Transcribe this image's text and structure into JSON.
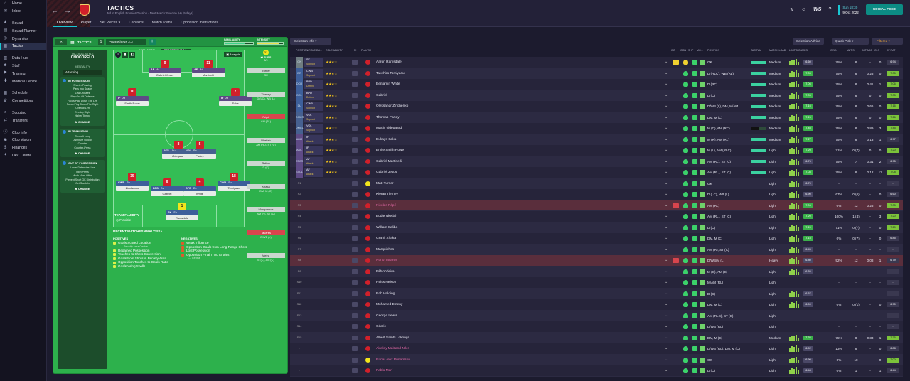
{
  "sidebar": {
    "items": [
      {
        "label": "Home",
        "icon": "home-icon"
      },
      {
        "label": "Inbox",
        "icon": "inbox-icon"
      },
      {
        "label": "Squad",
        "icon": "squad-icon"
      },
      {
        "label": "Squad Planner",
        "icon": "planner-icon"
      },
      {
        "label": "Dynamics",
        "icon": "dynamics-icon"
      },
      {
        "label": "Tactics",
        "icon": "tactics-icon",
        "active": true
      },
      {
        "label": "Data Hub",
        "icon": "datahub-icon"
      },
      {
        "label": "Staff",
        "icon": "staff-icon"
      },
      {
        "label": "Training",
        "icon": "training-icon"
      },
      {
        "label": "Medical Centre",
        "icon": "medical-icon"
      },
      {
        "label": "Schedule",
        "icon": "schedule-icon"
      },
      {
        "label": "Competitions",
        "icon": "competitions-icon"
      },
      {
        "label": "Scouting",
        "icon": "scouting-icon"
      },
      {
        "label": "Transfers",
        "icon": "transfers-icon"
      },
      {
        "label": "Club Info",
        "icon": "club-info-icon"
      },
      {
        "label": "Club Vision",
        "icon": "club-vision-icon"
      },
      {
        "label": "Finances",
        "icon": "finances-icon"
      },
      {
        "label": "Dev. Centre",
        "icon": "dev-centre-icon"
      }
    ]
  },
  "header": {
    "title": "TACTICS",
    "subtitle": "3rd in English Premier Division · Next Match: Everton (H) (9 days)",
    "tabs": [
      "Overview",
      "Player",
      "Set Pieces ▾",
      "Captains",
      "Match Plans",
      "Opposition Instructions"
    ],
    "date_time": "Sun 18:30",
    "date": "9 Oct 2022",
    "social_button": "SOCIAL FEED",
    "brand": "WS"
  },
  "left": {
    "tactics_label": "TACTICS",
    "slot": "1",
    "tactic_name": "Prometheus 2.2",
    "familiarity_label": "FAMILIARITY",
    "intensity_label": "INTENSITY",
    "familiarity": 0.72,
    "intensity": 0.85,
    "style_label": "TACTICAL STYLE",
    "style_value": "CHOCORELO",
    "mentality_label": "MENTALITY",
    "mentality_value": "Attacking",
    "in_possession_label": "IN POSSESSION",
    "in_possession": [
      "Shorter Passing",
      "Pass Into Space",
      "Low Crosses",
      "Play Out Of Defence",
      "Focus Play Down The Left",
      "Focus Play Down The Right",
      "Overlap Left",
      "Overlap Right",
      "Higher Tempo"
    ],
    "in_transition_label": "IN TRANSITION",
    "in_transition": [
      "Throw It Long",
      "Distribute Quickly",
      "Counter",
      "Counter-Press"
    ],
    "out_possession_label": "OUT OF POSSESSION",
    "out_possession": [
      "Lower Defensive Line",
      "High Press",
      "Much More Often",
      "Prevent Short GK Distribution",
      "Get Stuck In"
    ],
    "change_label": "CHANGE",
    "formation_label": "FORMATION",
    "formation_value": "PROMETHEUS 2.2 ▾",
    "analysis_label": "Analysis",
    "subs_label": "SUBS",
    "subs_count": "9/9",
    "team_fluidity_label": "TEAM FLUIDITY",
    "team_fluidity_value": "Flexible",
    "recent_label": "RECENT MATCHES ANALYSIS ›",
    "positives_label": "POSITIVES",
    "positives": [
      "Goals Scored Location",
      "Regained Possession",
      "Touches to Shots Conversion",
      "Goals from Shots in Penalty Area",
      "Opposition Touches to Goals Ratio",
      "Goalscoring Spells"
    ],
    "positive_sub": "— Penalty Area Centre",
    "negatives_label": "NEGATIVES",
    "negatives": [
      "Weak Influence",
      "Opposition Goals from Long-Range Shots",
      "Lost Possession",
      "Opposition Final Third Entries"
    ],
    "negative_sub": "— Central"
  },
  "pitch_players": [
    {
      "num": "9",
      "role": "AF",
      "duty": "At",
      "name": "Gabriel Jesus",
      "cls": "att"
    },
    {
      "num": "11",
      "role": "AF",
      "duty": "At",
      "name": "Martinelli",
      "cls": "att"
    },
    {
      "num": "10",
      "role": "IF",
      "duty": "At",
      "name": "Smith Rowe",
      "cls": "att"
    },
    {
      "num": "7",
      "role": "IF",
      "duty": "At",
      "name": "Saka",
      "cls": "att"
    },
    {
      "num": "8",
      "role": "VOL",
      "duty": "Su",
      "name": "Ødegaard",
      "cls": "mid"
    },
    {
      "num": "5",
      "role": "VOL",
      "duty": "Su",
      "name": "Partey",
      "cls": "mid"
    },
    {
      "num": "35",
      "role": "CWB",
      "duty": "Su",
      "name": "Zinchenko",
      "cls": "def"
    },
    {
      "num": "6",
      "role": "BPD",
      "duty": "De",
      "name": "Gabriel",
      "cls": "def"
    },
    {
      "num": "4",
      "role": "BPD",
      "duty": "De",
      "name": "White",
      "cls": "def"
    },
    {
      "num": "18",
      "role": "CWB",
      "duty": "Su",
      "name": "Tomiyasu",
      "cls": "def"
    },
    {
      "num": "1",
      "role": "SK",
      "duty": "Su",
      "name": "Ramsdale",
      "cls": "def"
    }
  ],
  "subs": [
    {
      "name": "Turner",
      "pos": "GK",
      "red": false
    },
    {
      "name": "Tierney",
      "pos": "D (LC), WB (L)",
      "red": false
    },
    {
      "name": "Pépé",
      "pos": "AM (RL)",
      "red": true
    },
    {
      "name": "Nketiah",
      "pos": "AM (RL), ST (C)",
      "red": false
    },
    {
      "name": "Saliba",
      "pos": "D (C)",
      "red": false
    },
    {
      "name": "Xhaka",
      "pos": "DM, M (C)",
      "red": false
    },
    {
      "name": "Marquinhos",
      "pos": "AM (R), ST (C)",
      "red": false
    },
    {
      "name": "Tavares",
      "pos": "D/WB (L)",
      "red": true
    },
    {
      "name": "Vieira",
      "pos": "M (C), AM (C)",
      "red": false
    }
  ],
  "right": {
    "selection_info": "Selection Info ▾",
    "selection_advice": "Selection Advice",
    "quick_pick": "Quick Pick ▾",
    "filter": "Filtered ▾",
    "columns": [
      "POSITION/ROLE/DU...",
      "ROLE ABILITY",
      "PI",
      "PLAYER",
      "INF",
      "CON",
      "SHP",
      "MO...",
      "POSITION",
      "TAC FAM",
      "MATCH LOAD",
      "LAST 5 GAMES",
      "GWIN",
      "APPS",
      "ASTS/90",
      "GLS",
      "AV RAT"
    ]
  },
  "players": [
    {
      "pos": "GK",
      "pcls": "gk",
      "role": "SK",
      "duty": "Support",
      "stars": "★★★☆",
      "name": "Aaron Ramsdale",
      "position": "GK",
      "tac": 1.0,
      "load": "Medium",
      "rating": "6.60",
      "gwin": "75%",
      "apps": "8",
      "asts": "-",
      "gls": "0",
      "avr": "6.94",
      "av_green": false,
      "cond": "#f0d030"
    },
    {
      "pos": "DR",
      "pcls": "def",
      "role": "CWB",
      "duty": "Support",
      "stars": "★★★☆",
      "name": "Takehiro Tomiyasu",
      "position": "D (RLC), WB (RL)",
      "tac": 1.0,
      "load": "Medium",
      "rating": "7.05",
      "gwin": "75%",
      "apps": "8",
      "asts": "0.25",
      "gls": "0",
      "avr": "7.05",
      "av_green": true,
      "cond": "#3bd16a"
    },
    {
      "pos": "DCR",
      "pcls": "def",
      "role": "BPD",
      "duty": "Defend",
      "stars": "★★★☆",
      "name": "Benjamin White",
      "position": "D (RC)",
      "tac": 1.0,
      "load": "Medium",
      "rating": "7.06",
      "gwin": "75%",
      "apps": "8",
      "asts": "0.41",
      "gls": "1",
      "avr": "7.06",
      "av_green": true,
      "cond": "#3bd16a"
    },
    {
      "pos": "DCL",
      "pcls": "def",
      "role": "BPD",
      "duty": "Defend",
      "stars": "★★★☆",
      "name": "Gabriel",
      "position": "D (C)",
      "tac": 1.0,
      "load": "Medium",
      "rating": "7.05",
      "gwin": "75%",
      "apps": "8",
      "asts": "0",
      "gls": "0",
      "avr": "7.05",
      "av_green": true,
      "cond": "#3bd16a"
    },
    {
      "pos": "DL",
      "pcls": "def",
      "role": "CWB",
      "duty": "Support",
      "stars": "★★★★",
      "name": "Oleksandr Zinchenko",
      "position": "D/WB (L), DM, M/AM...",
      "tac": 1.0,
      "load": "Medium",
      "rating": "7.16",
      "gwin": "75%",
      "apps": "8",
      "asts": "0.66",
      "gls": "0",
      "avr": "7.16",
      "av_green": true,
      "cond": "#3bd16a"
    },
    {
      "pos": "DMCR",
      "pcls": "mid",
      "role": "VOL",
      "duty": "Support",
      "stars": "★★★☆",
      "name": "Thomas Partey",
      "position": "DM, M (C)",
      "tac": 1.0,
      "load": "Medium",
      "rating": "7.26",
      "gwin": "75%",
      "apps": "8",
      "asts": "0",
      "gls": "0",
      "avr": "7.26",
      "av_green": true,
      "cond": "#3bd16a"
    },
    {
      "pos": "DMCL",
      "pcls": "mid",
      "role": "VOL",
      "duty": "Support",
      "stars": "★★☆☆",
      "name": "Martin Ødegaard",
      "position": "M (C), AM (RC)",
      "tac": 0.5,
      "load": "Medium",
      "rating": "7.45",
      "gwin": "75%",
      "apps": "8",
      "asts": "0.89",
      "gls": "3",
      "avr": "7.45",
      "av_green": true,
      "cond": "#3bd16a"
    },
    {
      "pos": "AMR",
      "pcls": "att",
      "role": "IF",
      "duty": "Attack",
      "stars": "★★★☆",
      "name": "Bukayo Saka",
      "position": "M (R), AM (RL)",
      "tac": 1.0,
      "load": "Medium",
      "rating": "7.27",
      "gwin": "75%",
      "apps": "8",
      "asts": "0.13",
      "gls": "1",
      "avr": "6.97",
      "av_green": false,
      "cond": "#3bd16a"
    },
    {
      "pos": "AML",
      "pcls": "att",
      "role": "IF",
      "duty": "Attack",
      "stars": "★★★☆",
      "name": "Emile Smith Rowe",
      "position": "M (L), AM (RLC)",
      "tac": 1.0,
      "load": "Light",
      "rating": "7.20",
      "gwin": "71%",
      "apps": "0 (7)",
      "asts": "0",
      "gls": "0",
      "avr": "7.20",
      "av_green": true,
      "cond": "#3bd16a"
    },
    {
      "pos": "STCR",
      "pcls": "att",
      "role": "AF",
      "duty": "Attack",
      "stars": "★★★☆",
      "name": "Gabriel Martinelli",
      "position": "AM (RL), ST (C)",
      "tac": 1.0,
      "load": "Light",
      "rating": "6.76",
      "gwin": "75%",
      "apps": "7",
      "asts": "0.31",
      "gls": "2",
      "avr": "6.95",
      "av_green": false,
      "cond": "#3bd16a"
    },
    {
      "pos": "STCL",
      "pcls": "att",
      "role": "AF",
      "duty": "Attack",
      "stars": "★★★★",
      "name": "Gabriel Jesus",
      "position": "AM (RL), ST (C)",
      "tac": 1.0,
      "load": "Light",
      "rating": "7.08",
      "gwin": "75%",
      "apps": "8",
      "asts": "0.12",
      "gls": "11",
      "avr": "7.08",
      "av_green": true,
      "cond": "#3bd16a"
    },
    {
      "pos": "S1",
      "pcls": "sub",
      "role": "",
      "duty": "",
      "stars": "",
      "name": "Matt Turner",
      "position": "GK",
      "tac": 0,
      "load": "Light",
      "rating": "6.70",
      "gwin": "-",
      "apps": "-",
      "asts": "-",
      "gls": "-",
      "avr": "-",
      "av_green": false,
      "cond": "#3bd16a"
    },
    {
      "pos": "S2",
      "pcls": "sub",
      "role": "",
      "duty": "",
      "stars": "",
      "name": "Kieran Tierney",
      "position": "D (LC), WB (L)",
      "tac": 0,
      "load": "Light",
      "rating": "6.90",
      "gwin": "67%",
      "apps": "0 (6)",
      "asts": "-",
      "gls": "0",
      "avr": "6.60",
      "av_green": false,
      "cond": "#3bd16a"
    },
    {
      "pos": "S3",
      "pcls": "sub",
      "role": "",
      "duty": "",
      "stars": "",
      "name": "Nicolas Pépé",
      "position": "AM (RL)",
      "tac": 0,
      "load": "Light",
      "rating": "7.06",
      "gwin": "0%",
      "apps": "12",
      "asts": "0.25",
      "gls": "0",
      "avr": "7.05",
      "av_green": true,
      "cond": "#3bd16a",
      "pink": true,
      "sel": true
    },
    {
      "pos": "S4",
      "pcls": "sub",
      "role": "",
      "duty": "",
      "stars": "",
      "name": "Eddie Nketiah",
      "position": "AM (RL), ST (C)",
      "tac": 0,
      "load": "Light",
      "rating": "7.20",
      "gwin": "100%",
      "apps": "1 (4)",
      "asts": "-",
      "gls": "3",
      "avr": "7.20",
      "av_green": true,
      "cond": "#3bd16a"
    },
    {
      "pos": "S5",
      "pcls": "sub",
      "role": "",
      "duty": "",
      "stars": "",
      "name": "William Saliba",
      "position": "D (C)",
      "tac": 0,
      "load": "Light",
      "rating": "7.20",
      "gwin": "71%",
      "apps": "0 (7)",
      "asts": "-",
      "gls": "0",
      "avr": "7.20",
      "av_green": true,
      "cond": "#3bd16a"
    },
    {
      "pos": "S6",
      "pcls": "sub",
      "role": "",
      "duty": "",
      "stars": "",
      "name": "Granit Xhaka",
      "position": "DM, M (C)",
      "tac": 0,
      "load": "Light",
      "rating": "7.15",
      "gwin": "0%",
      "apps": "0 (7)",
      "asts": "-",
      "gls": "0",
      "avr": "6.85",
      "av_green": false,
      "cond": "#3bd16a"
    },
    {
      "pos": "S7",
      "pcls": "sub",
      "role": "",
      "duty": "",
      "stars": "",
      "name": "Marquinhos",
      "position": "AM (R), ST (C)",
      "tac": 0,
      "load": "Light",
      "rating": "6.45",
      "gwin": "-",
      "apps": "-",
      "asts": "-",
      "gls": "-",
      "avr": "-",
      "av_green": false,
      "cond": "#3bd16a"
    },
    {
      "pos": "S8",
      "pcls": "sub",
      "role": "",
      "duty": "",
      "stars": "",
      "name": "Nuno Tavares",
      "position": "D/WB/M (L)",
      "tac": 0,
      "load": "Heavy",
      "rating": "6.80",
      "gwin": "92%",
      "apps": "12",
      "asts": "0.08",
      "gls": "1",
      "avr": "6.79",
      "av_green": false,
      "cond": "#3bd16a",
      "pink": true,
      "sel": true
    },
    {
      "pos": "S9",
      "pcls": "sub",
      "role": "",
      "duty": "",
      "stars": "",
      "name": "Fábio Vieira",
      "position": "M (C), AM (C)",
      "tac": 0,
      "load": "Light",
      "rating": "6.55",
      "gwin": "-",
      "apps": "-",
      "asts": "-",
      "gls": "-",
      "avr": "-",
      "av_green": false,
      "cond": "#3bd16a"
    },
    {
      "pos": "S10",
      "pcls": "sub",
      "role": "",
      "duty": "",
      "stars": "",
      "name": "Reiss Nelson",
      "position": "M/AM (RL)",
      "tac": 0,
      "load": "Light",
      "rating": "",
      "gwin": "-",
      "apps": "-",
      "asts": "-",
      "gls": "-",
      "avr": "-",
      "av_green": false,
      "cond": "#3bd16a"
    },
    {
      "pos": "S11",
      "pcls": "sub",
      "role": "",
      "duty": "",
      "stars": "",
      "name": "Rob Holding",
      "position": "D (C)",
      "tac": 0,
      "load": "Light",
      "rating": "6.67",
      "gwin": "-",
      "apps": "-",
      "asts": "-",
      "gls": "-",
      "avr": "-",
      "av_green": false,
      "cond": "#3bd16a"
    },
    {
      "pos": "S12",
      "pcls": "sub",
      "role": "",
      "duty": "",
      "stars": "",
      "name": "Mohamed Elneny",
      "position": "DM, M (C)",
      "tac": 0,
      "load": "Light",
      "rating": "6.90",
      "gwin": "0%",
      "apps": "0 (1)",
      "asts": "-",
      "gls": "0",
      "avr": "6.90",
      "av_green": false,
      "cond": "#3bd16a"
    },
    {
      "pos": "S13",
      "pcls": "sub",
      "role": "",
      "duty": "",
      "stars": "",
      "name": "George Lewis",
      "position": "AM (RLC), ST (C)",
      "tac": 0,
      "load": "Light",
      "rating": "",
      "gwin": "-",
      "apps": "-",
      "asts": "-",
      "gls": "-",
      "avr": "-",
      "av_green": false,
      "cond": "#3bd16a"
    },
    {
      "pos": "S14",
      "pcls": "sub",
      "role": "",
      "duty": "",
      "stars": "",
      "name": "Cédric",
      "position": "D/WB (RL)",
      "tac": 0,
      "load": "Light",
      "rating": "",
      "gwin": "-",
      "apps": "-",
      "asts": "-",
      "gls": "-",
      "avr": "-",
      "av_green": false,
      "cond": "#3bd16a"
    },
    {
      "pos": "S15",
      "pcls": "sub",
      "role": "",
      "duty": "",
      "stars": "",
      "name": "Albert Sambi Lokonga",
      "position": "DM, M (C)",
      "tac": 0,
      "load": "Medium",
      "rating": "7.35",
      "gwin": "75%",
      "apps": "8",
      "asts": "0.33",
      "gls": "1",
      "avr": "7.35",
      "av_green": true,
      "cond": "#3bd16a"
    },
    {
      "pos": "-",
      "pcls": "sub",
      "role": "",
      "duty": "",
      "stars": "",
      "name": "Ainsley Maitland-Niles",
      "position": "D/WB (RL), DM, M (C)",
      "tac": 0,
      "load": "Light",
      "rating": "6.92",
      "gwin": "13%",
      "apps": "8",
      "asts": "-",
      "gls": "0",
      "avr": "6.88",
      "av_green": false,
      "cond": "#3bd16a",
      "pink": true
    },
    {
      "pos": "-",
      "pcls": "sub",
      "role": "",
      "duty": "",
      "stars": "",
      "name": "Rúnar Alex Rúnarsson",
      "position": "GK",
      "tac": 0,
      "load": "Light",
      "rating": "6.90",
      "gwin": "0%",
      "apps": "10",
      "asts": "-",
      "gls": "0",
      "avr": "7.00",
      "av_green": true,
      "cond": "#3bd16a",
      "pink": true
    },
    {
      "pos": "-",
      "pcls": "sub",
      "role": "",
      "duty": "",
      "stars": "",
      "name": "Pablo Marí",
      "position": "D (C)",
      "tac": 0,
      "load": "Light",
      "rating": "6.44",
      "gwin": "0%",
      "apps": "1",
      "asts": "-",
      "gls": "1",
      "avr": "6.44",
      "av_green": false,
      "cond": "#3bd16a",
      "pink": true
    }
  ]
}
